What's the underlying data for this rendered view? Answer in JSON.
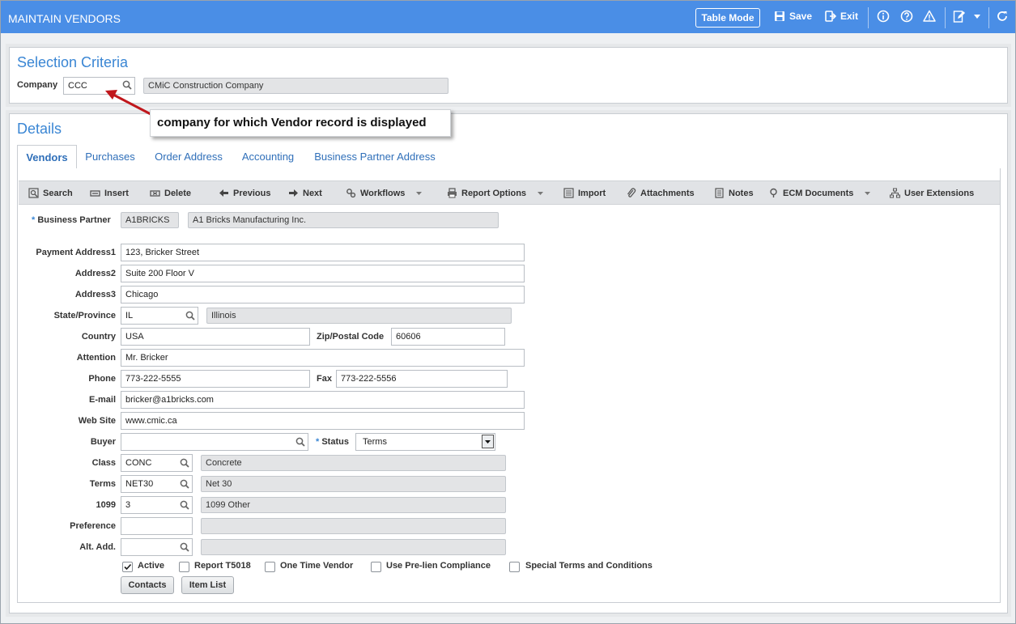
{
  "header": {
    "title": "MAINTAIN VENDORS",
    "table_mode": "Table Mode",
    "save": "Save",
    "exit": "Exit"
  },
  "selection": {
    "title": "Selection Criteria",
    "company_label": "Company",
    "company_value": "CCC",
    "company_name": "CMiC Construction Company"
  },
  "callout": "company for which Vendor record is displayed",
  "details": {
    "title": "Details",
    "tabs": [
      "Vendors",
      "Purchases",
      "Order Address",
      "Accounting",
      "Business Partner Address"
    ],
    "toolbar": {
      "search": "Search",
      "insert": "Insert",
      "delete": "Delete",
      "previous": "Previous",
      "next": "Next",
      "workflows": "Workflows",
      "report_options": "Report Options",
      "import": "Import",
      "attachments": "Attachments",
      "notes": "Notes",
      "ecm_documents": "ECM Documents",
      "user_extensions": "User Extensions"
    }
  },
  "form": {
    "business_partner_label": "Business Partner",
    "business_partner_code": "A1BRICKS",
    "business_partner_name": "A1 Bricks Manufacturing Inc.",
    "address1_label": "Payment Address1",
    "address1": "123, Bricker Street",
    "address2_label": "Address2",
    "address2": "Suite 200 Floor V",
    "address3_label": "Address3",
    "address3": "Chicago",
    "state_label": "State/Province",
    "state_code": "IL",
    "state_name": "Illinois",
    "country_label": "Country",
    "country": "USA",
    "zip_label": "Zip/Postal Code",
    "zip": "60606",
    "attention_label": "Attention",
    "attention": "Mr. Bricker",
    "phone_label": "Phone",
    "phone": "773-222-5555",
    "fax_label": "Fax",
    "fax": "773-222-5556",
    "email_label": "E-mail",
    "email": "bricker@a1bricks.com",
    "website_label": "Web Site",
    "website": "www.cmic.ca",
    "buyer_label": "Buyer",
    "buyer": "",
    "status_label": "Status",
    "status": "Terms",
    "class_label": "Class",
    "class_code": "CONC",
    "class_name": "Concrete",
    "terms_label": "Terms",
    "terms_code": "NET30",
    "terms_name": "Net 30",
    "t1099_label": "1099",
    "t1099_code": "3",
    "t1099_name": "1099 Other",
    "preference_label": "Preference",
    "preference_code": "",
    "preference_name": "",
    "alt_add_label": "Alt. Add.",
    "alt_add_code": "",
    "alt_add_name": ""
  },
  "checkboxes": [
    {
      "label": "Active",
      "checked": true
    },
    {
      "label": "Report T5018",
      "checked": false
    },
    {
      "label": "One Time Vendor",
      "checked": false
    },
    {
      "label": "Use Pre-lien Compliance",
      "checked": false
    },
    {
      "label": "Special Terms and Conditions",
      "checked": false
    }
  ],
  "buttons": {
    "contacts": "Contacts",
    "item_list": "Item List"
  },
  "colors": {
    "header": "#4a8ee6",
    "accent": "#3a86d4",
    "arrow": "#c0171c"
  }
}
